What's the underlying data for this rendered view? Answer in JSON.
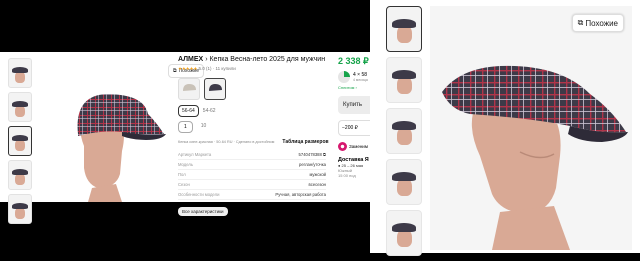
{
  "similar_label": "Похожие",
  "product": {
    "brand": "АЛМЕХ",
    "brand_arrow": "›",
    "title": "Кепка Весна-лето 2025 для мужчин",
    "stars": "★★★★★",
    "rating_text": "5.0 (1) · 11 купили",
    "sizes": [
      "56-64",
      "54-62"
    ],
    "quantities": [
      "1",
      "10"
    ],
    "note": "Кепка сине-красная · 50-64 RU · Сделано в достойном",
    "size_table": "Таблица размеров",
    "specs": [
      {
        "k": "Артикул Маркета",
        "v": "5740478388 ⧉"
      },
      {
        "k": "Модель",
        "v": "реглан/уточка"
      },
      {
        "k": "Пол",
        "v": "мужской"
      },
      {
        "k": "Сезон",
        "v": "всесезон"
      },
      {
        "k": "Особенности модели",
        "v": "Ручная, авторская работа"
      }
    ],
    "all_specs": "Все характеристики"
  },
  "buy": {
    "price": "2 338 ₽",
    "split_amount": "4 × 58",
    "split_sub": "4 месяца",
    "split_green": "Сплитом ›",
    "buy_label": "Купить",
    "discount": "−200 ₽",
    "replace_label": "Заменим",
    "delivery_title": "Доставка Я",
    "delivery_date": "● 25 – 26 мая",
    "delivery_sub": "Южный",
    "delivery_sub2": "15 00 под"
  },
  "colors": {
    "accent_green": "#16a34a",
    "star": "#f5a623",
    "cap_plaid": "#3d3a48",
    "mannequin": "#d9a995"
  }
}
